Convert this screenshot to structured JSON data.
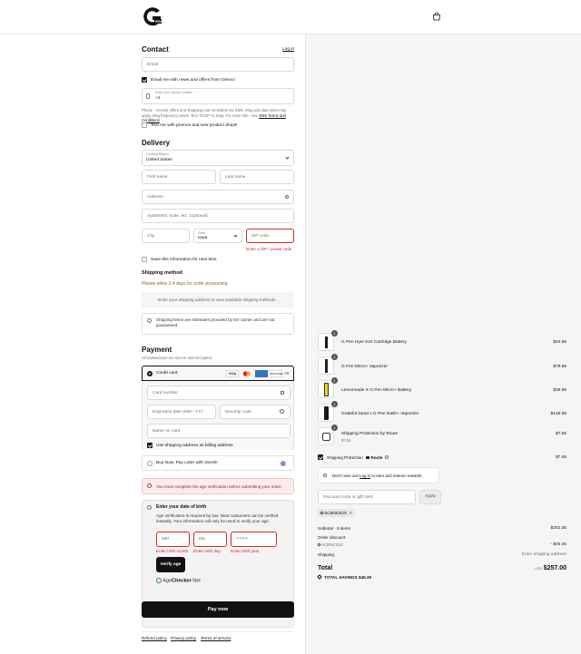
{
  "header": {
    "logo_icon": "g-pen-logo-icon",
    "bag_icon": "shopping-bag-icon"
  },
  "contact": {
    "heading": "Contact",
    "login_link": "Log in",
    "email_placeholder": "Email",
    "newsletter_label": "Email me with news and offers from Grenco",
    "phone_label": "Enter your phone number",
    "phone_value": "+1",
    "disclaimer": "Phone - receive offers and shopping cart reminders via SMS. Msg and data rates may apply. Msg frequency varies. Text 'STOP' to Stop. For more info - see",
    "disclaimer_link": "SMS Terms and Conditions",
    "text_label": "Text me with promos and new product drops!"
  },
  "delivery": {
    "heading": "Delivery",
    "country_label": "Country/Region",
    "country_value": "United States",
    "first_name": "First name",
    "last_name": "Last name",
    "address": "Address",
    "apartment": "Apartment, suite, etc. (optional)",
    "city": "City",
    "state_label": "State",
    "state_value": "Iowa",
    "zip": "ZIP code",
    "zip_error": "Enter a ZIP / postal code",
    "save_label": "Save this information for next time"
  },
  "shipping": {
    "heading": "Shipping method",
    "processing": "Please allow 2-4 days for order processing",
    "placeholder": "Enter your shipping address to view available shipping methods.",
    "note": "Shipping times are estimates provided by the carrier and are not guaranteed."
  },
  "payment": {
    "heading": "Payment",
    "subtitle": "All transactions are secure and encrypted.",
    "credit_card": "Credit card",
    "more_cards": "+3",
    "card_number": "Card number",
    "expiration": "Expiration date (MM / YY)",
    "security": "Security code",
    "name_on_card": "Name on card",
    "billing_label": "Use shipping address as billing address",
    "sezzle": "Buy Now, Pay Later with Sezzle"
  },
  "age": {
    "warning": "You must complete the age verification before submitting your order.",
    "heading": "Enter your date of birth",
    "desc": "Age verification is required by law. Most customers can be verified instantly. Your information will only be used to verify your age.",
    "mm": "MM",
    "dd": "DD",
    "yyyy": "YYYY",
    "err_month": "Enter birth month",
    "err_day": "Enter birth day",
    "err_year": "Enter birth year",
    "verify_button": "Verify age",
    "brand_a": "Age",
    "brand_b": "Checker",
    "brand_c": ".Net"
  },
  "pay_now": "Pay now",
  "footer_links": [
    "Refund policy",
    "Privacy policy",
    "Terms of service"
  ],
  "cart": {
    "items": [
      {
        "qty": "1",
        "name": "G Pen Hyer 510 Cartridge Battery",
        "price": "$24.95",
        "color": "#1a1a1a"
      },
      {
        "qty": "1",
        "name": "G Pen Micro+ Vaporizer",
        "price": "$79.95",
        "color": "#222222"
      },
      {
        "qty": "1",
        "name": "Lemonnade X G Pen Micro+ Battery",
        "price": "$39.95",
        "color": "#f2d214"
      },
      {
        "qty": "1",
        "name": "Grateful Dead x G Pen Dash+ Vaporizer",
        "price": "$149.95",
        "color": "#1a1a1a"
      },
      {
        "qty": "1",
        "name": "Shipping Protection by Route",
        "sub": "$7.55",
        "price": "$7.55",
        "color": "#ffffff"
      }
    ],
    "protection_label": "Shipping Protection",
    "protection_brand": "Route",
    "protection_price": "$7.55",
    "missout_text": "Don't miss out!",
    "missout_link": "Log in",
    "missout_rest": "to earn and redeem rewards",
    "discount_placeholder": "Discount code or gift card",
    "apply": "Apply",
    "code_tag": "SCIENCE15",
    "subtotal_label": "Subtotal · 5 items",
    "subtotal_value": "$302.35",
    "order_discount_label": "Order discount",
    "discount_code": "SCIENCE15",
    "discount_value": "- $45.35",
    "shipping_label": "Shipping",
    "shipping_value": "Enter shipping address",
    "total_label": "Total",
    "currency": "USD",
    "total_value": "$257.00",
    "savings_label": "TOTAL SAVINGS",
    "savings_value": "$45.35"
  }
}
